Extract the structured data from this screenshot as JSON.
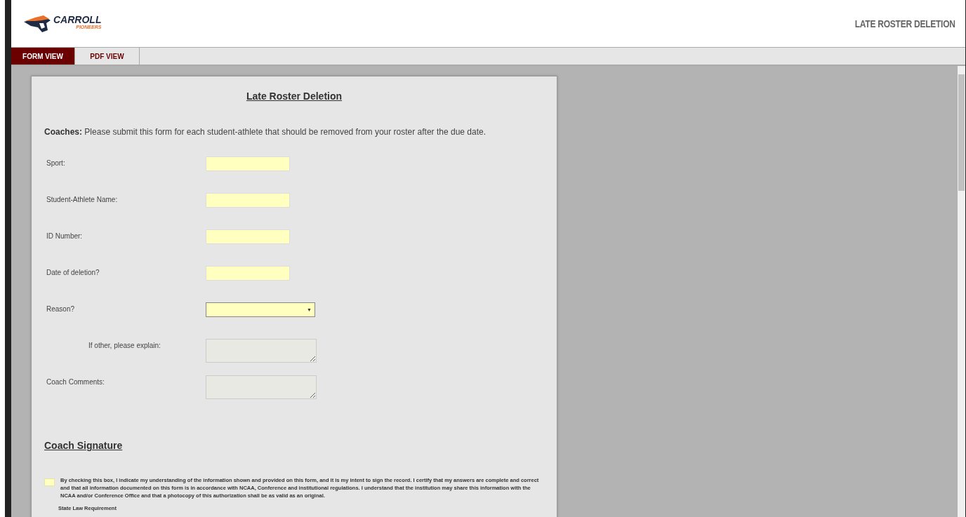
{
  "header": {
    "logo_name": "CARROLL",
    "logo_sub": "PIONEERS",
    "title": "LATE ROSTER DELETION"
  },
  "tabs": [
    {
      "label": "FORM VIEW",
      "selected": true
    },
    {
      "label": "PDF VIEW",
      "selected": false
    }
  ],
  "form": {
    "title": "Late Roster Deletion",
    "intro": "**Coaches:** Please submit this form for each student-athlete that should be removed from your roster after the due date.",
    "fields": [
      {
        "label": "Sport:",
        "kind": "text",
        "indented": false
      },
      {
        "label": "Student-Athlete Name:",
        "kind": "text",
        "indented": false
      },
      {
        "label": "ID Number:",
        "kind": "text",
        "indented": false
      },
      {
        "label": "Date of deletion?",
        "kind": "text",
        "indented": false
      },
      {
        "label": "Reason?",
        "kind": "select",
        "indented": false,
        "arrow": "▼"
      },
      {
        "label": "If other, please explain:",
        "kind": "textarea",
        "indented": true
      },
      {
        "label": "Coach Comments:",
        "kind": "textarea",
        "indented": false
      }
    ],
    "signature_heading": "Coach Signature",
    "signature": {
      "checked": false,
      "text": "By checking this box, I indicate my understanding of the information shown and provided on this form, and it is my intent to sign the record. I certify that my answers are complete and correct and that all information documented on this form is in accordance with NCAA, Conference and institutional regulations. I understand that the institution may share this information with the NCAA and/or Conference Office and that a photocopy of this authorization shall be as valid as an original."
    },
    "state_law": "State Law Requirement"
  }
}
